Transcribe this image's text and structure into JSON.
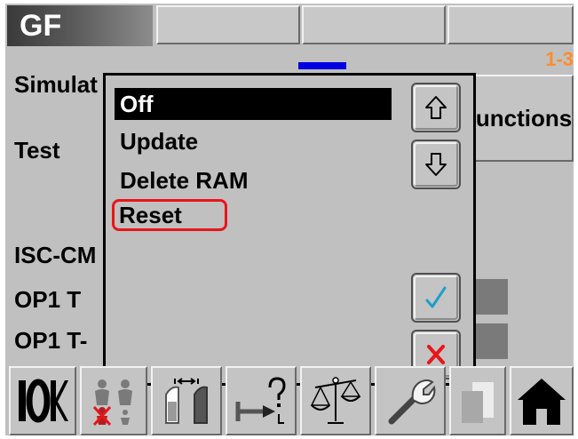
{
  "header": {
    "title": "GF",
    "page_indicator": "1-3"
  },
  "background": {
    "labels": {
      "simulation": "Simulat",
      "test": "Test",
      "isc": "ISC-CM",
      "op1t": "OP1 T",
      "op1tv": "OP1 T-"
    },
    "functions_button": "Functions"
  },
  "popup": {
    "items": [
      {
        "label": "Off",
        "selected": true
      },
      {
        "label": "Update"
      },
      {
        "label": "Delete RAM"
      },
      {
        "label": "Reset",
        "highlighted": true
      }
    ],
    "buttons": {
      "scroll_up": "arrow-up-icon",
      "scroll_down": "arrow-down-icon",
      "confirm": "checkmark-icon",
      "cancel": "x-icon"
    }
  },
  "toolbar": {
    "icons": [
      "io-icon",
      "persons-crossed-icon",
      "dispenser-icon",
      "wrench-question-icon",
      "scale-icon",
      "tools-icon",
      "pages-icon",
      "home-icon"
    ]
  },
  "colors": {
    "panel": "#c0c0c0",
    "selection": "#000000",
    "highlight_ring": "#e8151b",
    "page_indicator": "#ff8c2a",
    "confirm": "#1e9ec8",
    "cancel": "#e8151b",
    "blue_mark": "#0000e0"
  }
}
